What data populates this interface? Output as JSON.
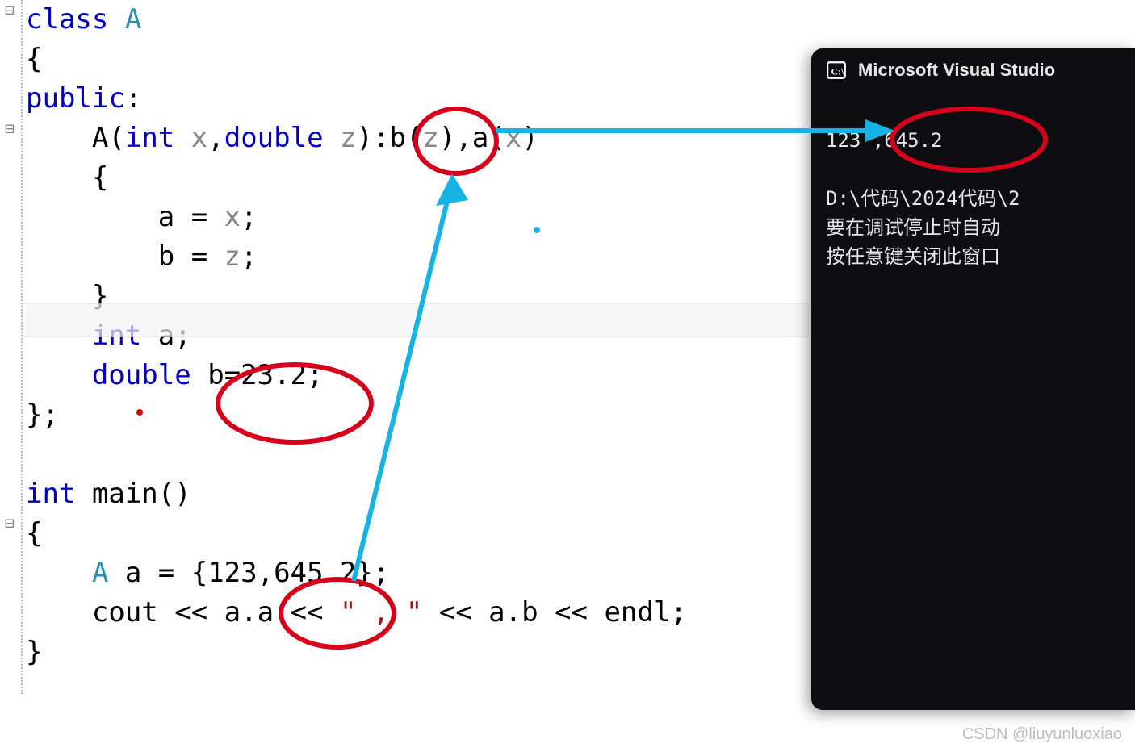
{
  "code": {
    "l1_kw": "class",
    "l1_name": " A",
    "l2": "{",
    "l3_kw": "public",
    "l3_colon": ":",
    "l4_indent": "    ",
    "l4_name": "A",
    "l4_p1": "(",
    "l4_int": "int",
    "l4_x1": " x",
    "l4_comma": ",",
    "l4_dbl": "double",
    "l4_z1": " z",
    "l4_p2": "):",
    "l4_b": "b",
    "l4_bp": "(",
    "l4_z2": "z",
    "l4_bp2": "),",
    "l4_a": "a",
    "l4_ap": "(",
    "l4_x2": "x",
    "l4_ap2": ")",
    "l5": "    {",
    "l6a": "        a = ",
    "l6b": "x",
    "l6c": ";",
    "l7a": "        b = ",
    "l7b": "z",
    "l7c": ";",
    "l8": "    }",
    "l9_indent": "    ",
    "l9_int": "int",
    "l9_rest": " a;",
    "l10_indent": "    ",
    "l10_dbl": "double",
    "l10_rest": " b=23.2;",
    "l11": "};",
    "blank": "",
    "l13_int": "int",
    "l13_rest": " main()",
    "l14": "{",
    "l15_indent": "    ",
    "l15_A": "A",
    "l15_rest": " a = {123,645.2};",
    "l16_indent": "    ",
    "l16_a": "cout << a.a << ",
    "l16_str": "\" , \"",
    "l16_b": " << a.b << endl;",
    "l17": "}"
  },
  "console": {
    "title": "Microsoft Visual Studio",
    "out1": "123 ,645.2",
    "path": "D:\\代码\\2024代码\\2",
    "msg1": "要在调试停止时自动",
    "msg2": "按任意键关闭此窗口"
  },
  "watermark": "CSDN @liuyunluoxiao",
  "folds": {
    "f1": "⊟",
    "f2": "⊟",
    "f3": "⊟"
  }
}
